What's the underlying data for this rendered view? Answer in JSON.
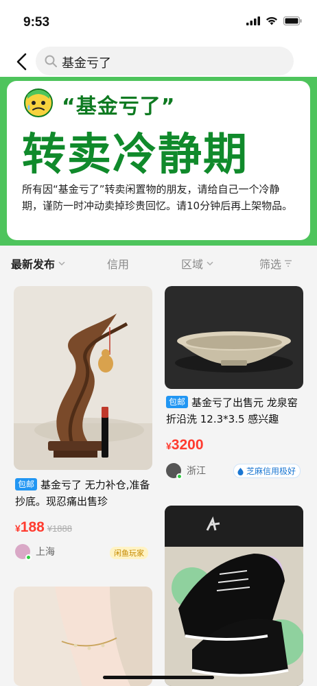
{
  "status_bar": {
    "time": "9:53"
  },
  "search": {
    "query": "基金亏了"
  },
  "banner": {
    "quote_title": "“基金亏了”",
    "headline": "转卖冷静期",
    "description": "所有因“基金亏了”转卖闲置物的朋友，请给自己一个冷静期，谨防一时冲动卖掉珍贵回忆。请10分钟后再上架物品。"
  },
  "filters": [
    {
      "label": "最新发布"
    },
    {
      "label": "信用"
    },
    {
      "label": "区域"
    },
    {
      "label": "筛选"
    }
  ],
  "items": [
    {
      "badge": "包邮",
      "title": "基金亏了 无力补仓,准备抄底。现忍痛出售珍",
      "price_symbol": "¥",
      "price": "188",
      "original_price": "¥1888",
      "location": "上海",
      "tag": "闲鱼玩家"
    },
    {
      "badge": "包邮",
      "title": "基金亏了出售元 龙泉窑折沿洗 12.3*3.5 感兴趣",
      "price_symbol": "¥",
      "price": "3200",
      "location": "浙江",
      "tag": "芝麻信用极好"
    }
  ],
  "colors": {
    "accent_green": "#4ec45c",
    "headline_green": "#108a2b",
    "price_red": "#ff3b2f",
    "badge_blue": "#2196f3"
  }
}
